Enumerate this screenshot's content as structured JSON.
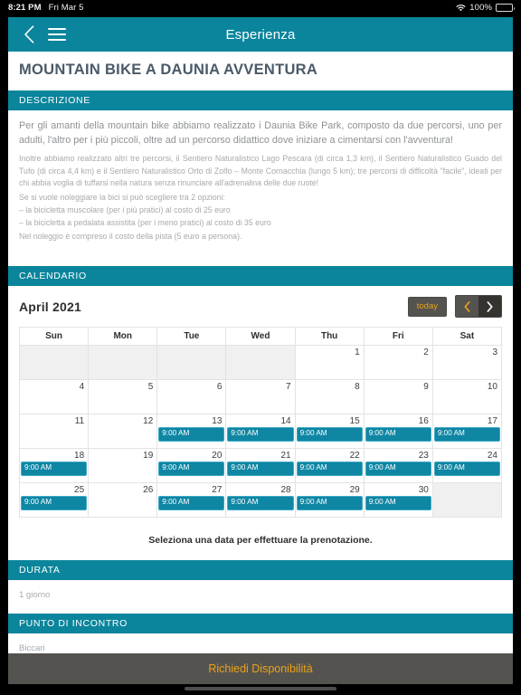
{
  "status_bar": {
    "time": "8:21 PM",
    "date": "Fri Mar 5",
    "battery_pct": "100%",
    "wifi_icon": "wifi-icon",
    "battery_icon": "battery-icon"
  },
  "navbar": {
    "title": "Esperienza",
    "back_icon": "chevron-left-icon",
    "menu_icon": "hamburger-menu-icon"
  },
  "page_title": "MOUNTAIN BIKE A DAUNIA AVVENTURA",
  "sections": {
    "descrizione": {
      "header": "DESCRIZIONE",
      "lead": "Per gli amanti della mountain bike abbiamo realizzato i Daunia Bike Park, composto da due percorsi, uno per adulti, l'altro per i più piccoli, oltre ad un percorso didattico dove iniziare a cimentarsi con l'avventura!",
      "paragraph": "Inoltre abbiamo realizzato altri tre percorsi, il Sentiero Naturalistico Lago Pescara (di circa 1,3 km), il Sentiero Naturalistico Guado del Tufo (di circa 4,4 km) e il Sentiero Naturalistico Orto di Zolfo – Monte Cornacchia (lungo 5 km); tre percorsi di difficoltà \"facile\", ideati per chi abbia voglia di tuffarsi nella natura senza rinunciare all'adrenalina delle due ruote!",
      "lines": [
        "Se si vuole noleggiare la bici si può scegliere tra 2 opzioni:",
        "– la bicicletta muscolare (per i più pratici) al costo di 25 euro",
        "– la bicicletta a pedalata assistita (per i meno pratici) al costo di 35 euro",
        "Nel noleggio è compreso il costo della pista (5 euro a persona)."
      ]
    },
    "calendario": {
      "header": "CALENDARIO",
      "month_label": "April 2021",
      "today_label": "today",
      "prev_icon": "chevron-left-icon",
      "next_icon": "chevron-right-icon",
      "prev_label": "‹",
      "next_label": "›",
      "weekdays": [
        "Sun",
        "Mon",
        "Tue",
        "Wed",
        "Thu",
        "Fri",
        "Sat"
      ],
      "event_label": "9:00 AM",
      "hint": "Seleziona una data per effettuare la prenotazione.",
      "weeks": [
        [
          {
            "day": "",
            "other": true,
            "event": false
          },
          {
            "day": "",
            "other": true,
            "event": false
          },
          {
            "day": "",
            "other": true,
            "event": false
          },
          {
            "day": "",
            "other": true,
            "event": false
          },
          {
            "day": "1",
            "other": false,
            "event": false
          },
          {
            "day": "2",
            "other": false,
            "event": false
          },
          {
            "day": "3",
            "other": false,
            "event": false
          }
        ],
        [
          {
            "day": "4",
            "other": false,
            "event": false
          },
          {
            "day": "5",
            "other": false,
            "event": false
          },
          {
            "day": "6",
            "other": false,
            "event": false
          },
          {
            "day": "7",
            "other": false,
            "event": false
          },
          {
            "day": "8",
            "other": false,
            "event": false
          },
          {
            "day": "9",
            "other": false,
            "event": false
          },
          {
            "day": "10",
            "other": false,
            "event": false
          }
        ],
        [
          {
            "day": "11",
            "other": false,
            "event": false
          },
          {
            "day": "12",
            "other": false,
            "event": false
          },
          {
            "day": "13",
            "other": false,
            "event": true
          },
          {
            "day": "14",
            "other": false,
            "event": true
          },
          {
            "day": "15",
            "other": false,
            "event": true
          },
          {
            "day": "16",
            "other": false,
            "event": true
          },
          {
            "day": "17",
            "other": false,
            "event": true
          }
        ],
        [
          {
            "day": "18",
            "other": false,
            "event": true
          },
          {
            "day": "19",
            "other": false,
            "event": false
          },
          {
            "day": "20",
            "other": false,
            "event": true
          },
          {
            "day": "21",
            "other": false,
            "event": true
          },
          {
            "day": "22",
            "other": false,
            "event": true
          },
          {
            "day": "23",
            "other": false,
            "event": true
          },
          {
            "day": "24",
            "other": false,
            "event": true
          }
        ],
        [
          {
            "day": "25",
            "other": false,
            "event": true
          },
          {
            "day": "26",
            "other": false,
            "event": false
          },
          {
            "day": "27",
            "other": false,
            "event": true
          },
          {
            "day": "28",
            "other": false,
            "event": true
          },
          {
            "day": "29",
            "other": false,
            "event": true
          },
          {
            "day": "30",
            "other": false,
            "event": true
          },
          {
            "day": "",
            "other": true,
            "event": false
          }
        ]
      ]
    },
    "durata": {
      "header": "DURATA",
      "value": "1 giorno"
    },
    "punto_di_incontro": {
      "header": "PUNTO DI INCONTRO",
      "value": "Biccari"
    }
  },
  "cta": {
    "label": "Richiedi Disponibilità"
  },
  "colors": {
    "teal": "#0b859c",
    "event_teal": "#0e86a4",
    "accent_orange": "#e8a317",
    "button_gray": "#55534f",
    "title_slate": "#4a5a68"
  }
}
